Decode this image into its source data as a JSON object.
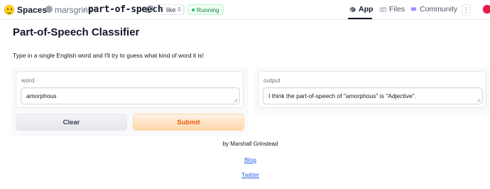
{
  "header": {
    "brand": "Spaces",
    "owner": "marsgrins",
    "separator": "/",
    "repo": "part-of-speech",
    "like_label": "like",
    "like_count": "0",
    "status": "Running",
    "tabs": [
      {
        "label": "App",
        "active": true
      },
      {
        "label": "Files",
        "active": false
      },
      {
        "label": "Community",
        "active": false
      }
    ],
    "menu_glyph": "⋮"
  },
  "main": {
    "title": "Part-of-Speech Classifier",
    "description": "Type in a single English word and I'll try to guess what kind of word it is!",
    "input": {
      "label": "word",
      "value": "amorphous"
    },
    "output": {
      "label": "output",
      "value": "I think the part-of-speech of \"amorphous\" is \"Adjective\"."
    },
    "buttons": {
      "clear": "Clear",
      "submit": "Submit"
    }
  },
  "footer": {
    "credit": "by Marshall Grinstead",
    "links": [
      "Blog",
      "Twitter"
    ]
  },
  "colors": {
    "accent_orange": "#ea580c",
    "status_green": "#15803d",
    "link_blue": "#2563eb"
  }
}
